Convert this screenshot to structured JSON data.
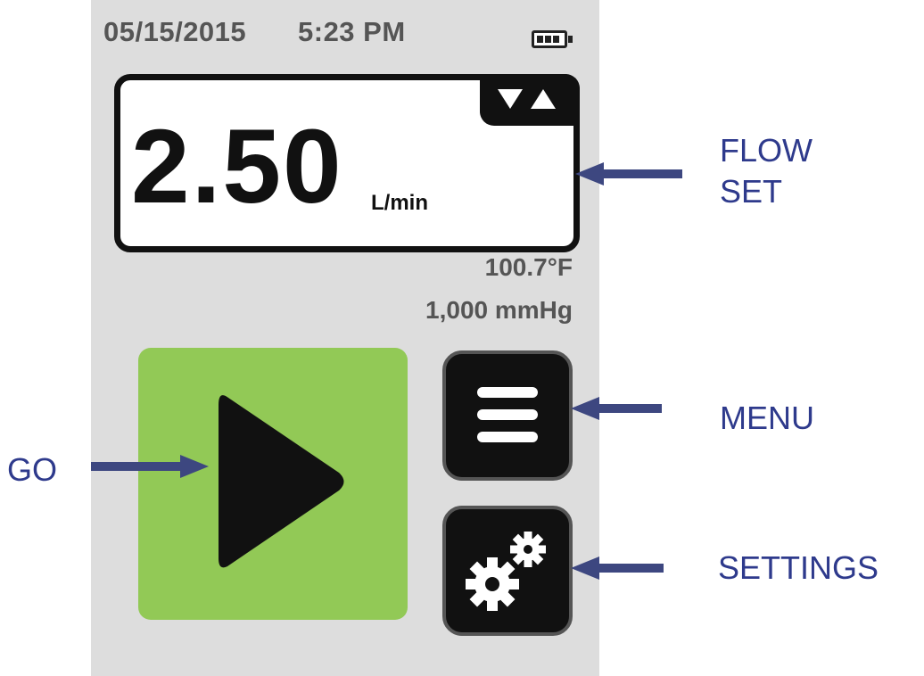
{
  "status_bar": {
    "date": "05/15/2015",
    "time": "5:23 PM",
    "battery_icon": "battery-icon",
    "battery_level": 0.75
  },
  "flow_display": {
    "value": "2.50",
    "unit": "L/min",
    "adjust_icons": [
      "arrow-down-icon",
      "arrow-up-icon"
    ]
  },
  "conditions": {
    "temperature": "100.7°F",
    "pressure": "1,000 mmHg"
  },
  "buttons": {
    "go_icon": "play-icon",
    "menu_icon": "hamburger-icon",
    "settings_icon": "gears-icon"
  },
  "callouts": {
    "flow_set_line1": "FLOW",
    "flow_set_line2": "SET",
    "menu": "MENU",
    "settings": "SETTINGS",
    "go": "GO"
  },
  "colors": {
    "screen_bg": "#dddddd",
    "go_button": "#92c956",
    "callout_text": "#2e3a8c",
    "callout_arrow": "#3d4780"
  }
}
